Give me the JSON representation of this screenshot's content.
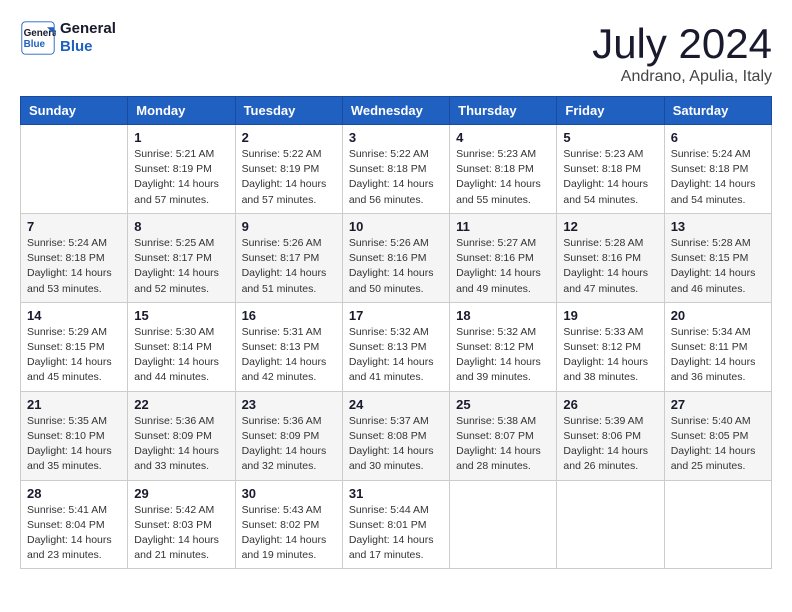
{
  "header": {
    "logo_line1": "General",
    "logo_line2": "Blue",
    "month_year": "July 2024",
    "location": "Andrano, Apulia, Italy"
  },
  "days_of_week": [
    "Sunday",
    "Monday",
    "Tuesday",
    "Wednesday",
    "Thursday",
    "Friday",
    "Saturday"
  ],
  "weeks": [
    [
      {
        "day": "",
        "info": ""
      },
      {
        "day": "1",
        "info": "Sunrise: 5:21 AM\nSunset: 8:19 PM\nDaylight: 14 hours\nand 57 minutes."
      },
      {
        "day": "2",
        "info": "Sunrise: 5:22 AM\nSunset: 8:19 PM\nDaylight: 14 hours\nand 57 minutes."
      },
      {
        "day": "3",
        "info": "Sunrise: 5:22 AM\nSunset: 8:18 PM\nDaylight: 14 hours\nand 56 minutes."
      },
      {
        "day": "4",
        "info": "Sunrise: 5:23 AM\nSunset: 8:18 PM\nDaylight: 14 hours\nand 55 minutes."
      },
      {
        "day": "5",
        "info": "Sunrise: 5:23 AM\nSunset: 8:18 PM\nDaylight: 14 hours\nand 54 minutes."
      },
      {
        "day": "6",
        "info": "Sunrise: 5:24 AM\nSunset: 8:18 PM\nDaylight: 14 hours\nand 54 minutes."
      }
    ],
    [
      {
        "day": "7",
        "info": "Sunrise: 5:24 AM\nSunset: 8:18 PM\nDaylight: 14 hours\nand 53 minutes."
      },
      {
        "day": "8",
        "info": "Sunrise: 5:25 AM\nSunset: 8:17 PM\nDaylight: 14 hours\nand 52 minutes."
      },
      {
        "day": "9",
        "info": "Sunrise: 5:26 AM\nSunset: 8:17 PM\nDaylight: 14 hours\nand 51 minutes."
      },
      {
        "day": "10",
        "info": "Sunrise: 5:26 AM\nSunset: 8:16 PM\nDaylight: 14 hours\nand 50 minutes."
      },
      {
        "day": "11",
        "info": "Sunrise: 5:27 AM\nSunset: 8:16 PM\nDaylight: 14 hours\nand 49 minutes."
      },
      {
        "day": "12",
        "info": "Sunrise: 5:28 AM\nSunset: 8:16 PM\nDaylight: 14 hours\nand 47 minutes."
      },
      {
        "day": "13",
        "info": "Sunrise: 5:28 AM\nSunset: 8:15 PM\nDaylight: 14 hours\nand 46 minutes."
      }
    ],
    [
      {
        "day": "14",
        "info": "Sunrise: 5:29 AM\nSunset: 8:15 PM\nDaylight: 14 hours\nand 45 minutes."
      },
      {
        "day": "15",
        "info": "Sunrise: 5:30 AM\nSunset: 8:14 PM\nDaylight: 14 hours\nand 44 minutes."
      },
      {
        "day": "16",
        "info": "Sunrise: 5:31 AM\nSunset: 8:13 PM\nDaylight: 14 hours\nand 42 minutes."
      },
      {
        "day": "17",
        "info": "Sunrise: 5:32 AM\nSunset: 8:13 PM\nDaylight: 14 hours\nand 41 minutes."
      },
      {
        "day": "18",
        "info": "Sunrise: 5:32 AM\nSunset: 8:12 PM\nDaylight: 14 hours\nand 39 minutes."
      },
      {
        "day": "19",
        "info": "Sunrise: 5:33 AM\nSunset: 8:12 PM\nDaylight: 14 hours\nand 38 minutes."
      },
      {
        "day": "20",
        "info": "Sunrise: 5:34 AM\nSunset: 8:11 PM\nDaylight: 14 hours\nand 36 minutes."
      }
    ],
    [
      {
        "day": "21",
        "info": "Sunrise: 5:35 AM\nSunset: 8:10 PM\nDaylight: 14 hours\nand 35 minutes."
      },
      {
        "day": "22",
        "info": "Sunrise: 5:36 AM\nSunset: 8:09 PM\nDaylight: 14 hours\nand 33 minutes."
      },
      {
        "day": "23",
        "info": "Sunrise: 5:36 AM\nSunset: 8:09 PM\nDaylight: 14 hours\nand 32 minutes."
      },
      {
        "day": "24",
        "info": "Sunrise: 5:37 AM\nSunset: 8:08 PM\nDaylight: 14 hours\nand 30 minutes."
      },
      {
        "day": "25",
        "info": "Sunrise: 5:38 AM\nSunset: 8:07 PM\nDaylight: 14 hours\nand 28 minutes."
      },
      {
        "day": "26",
        "info": "Sunrise: 5:39 AM\nSunset: 8:06 PM\nDaylight: 14 hours\nand 26 minutes."
      },
      {
        "day": "27",
        "info": "Sunrise: 5:40 AM\nSunset: 8:05 PM\nDaylight: 14 hours\nand 25 minutes."
      }
    ],
    [
      {
        "day": "28",
        "info": "Sunrise: 5:41 AM\nSunset: 8:04 PM\nDaylight: 14 hours\nand 23 minutes."
      },
      {
        "day": "29",
        "info": "Sunrise: 5:42 AM\nSunset: 8:03 PM\nDaylight: 14 hours\nand 21 minutes."
      },
      {
        "day": "30",
        "info": "Sunrise: 5:43 AM\nSunset: 8:02 PM\nDaylight: 14 hours\nand 19 minutes."
      },
      {
        "day": "31",
        "info": "Sunrise: 5:44 AM\nSunset: 8:01 PM\nDaylight: 14 hours\nand 17 minutes."
      },
      {
        "day": "",
        "info": ""
      },
      {
        "day": "",
        "info": ""
      },
      {
        "day": "",
        "info": ""
      }
    ]
  ]
}
